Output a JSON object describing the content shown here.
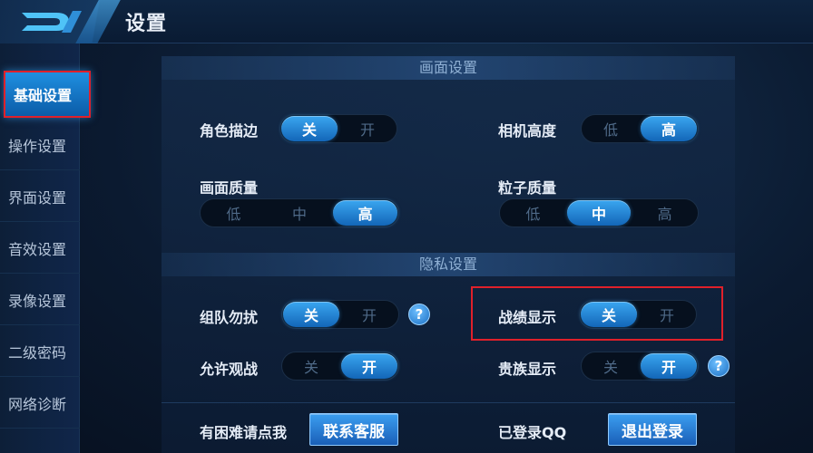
{
  "header": {
    "title": "设置"
  },
  "sidebar": {
    "items": [
      {
        "label": "基础设置",
        "active": true
      },
      {
        "label": "操作设置"
      },
      {
        "label": "界面设置"
      },
      {
        "label": "音效设置"
      },
      {
        "label": "录像设置"
      },
      {
        "label": "二级密码"
      },
      {
        "label": "网络诊断"
      }
    ]
  },
  "sections": {
    "display": "画面设置",
    "privacy": "隐私设置"
  },
  "settings": {
    "outline": {
      "label": "角色描边",
      "options": [
        "关",
        "开"
      ],
      "selected": "关"
    },
    "camera_height": {
      "label": "相机高度",
      "options": [
        "低",
        "高"
      ],
      "selected": "高"
    },
    "image_quality": {
      "label": "画面质量",
      "options": [
        "低",
        "中",
        "高"
      ],
      "selected": "高"
    },
    "particle_quality": {
      "label": "粒子质量",
      "options": [
        "低",
        "中",
        "高"
      ],
      "selected": "中"
    },
    "team_dnd": {
      "label": "组队勿扰",
      "options": [
        "关",
        "开"
      ],
      "selected": "关"
    },
    "record_display": {
      "label": "战绩显示",
      "options": [
        "关",
        "开"
      ],
      "selected": "关"
    },
    "allow_spectate": {
      "label": "允许观战",
      "options": [
        "关",
        "开"
      ],
      "selected": "开"
    },
    "noble_display": {
      "label": "贵族显示",
      "options": [
        "关",
        "开"
      ],
      "selected": "开"
    }
  },
  "footer": {
    "help_text": "有困难请点我",
    "contact_button": "联系客服",
    "login_status": "已登录QQ",
    "logout_button": "退出登录"
  },
  "icons": {
    "back": "back-logo-icon",
    "help": "question-icon"
  },
  "help_glyph": "?",
  "colors": {
    "accent": "#1f8fe0",
    "highlight_box": "#e0202a"
  }
}
